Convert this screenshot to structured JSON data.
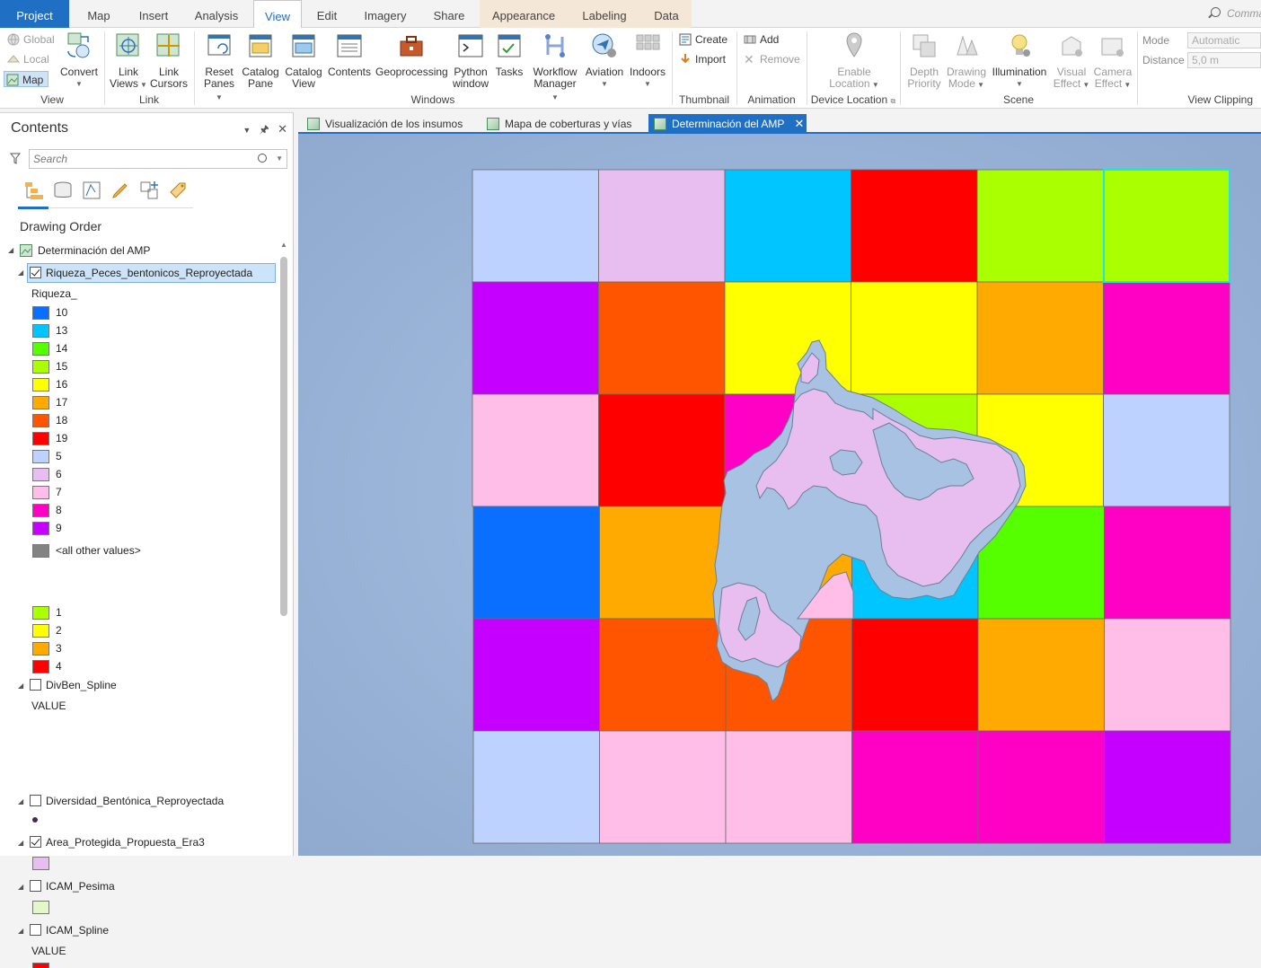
{
  "ribbon_tabs": {
    "project": "Project",
    "map": "Map",
    "insert": "Insert",
    "analysis": "Analysis",
    "view": "View",
    "edit": "Edit",
    "imagery": "Imagery",
    "share": "Share",
    "appearance": "Appearance",
    "labeling": "Labeling",
    "data": "Data"
  },
  "command_search": {
    "placeholder": "Comma"
  },
  "ribbon": {
    "view_group": {
      "global": "Global",
      "local": "Local",
      "map": "Map",
      "convert": "Convert",
      "label": "View"
    },
    "link_group": {
      "link_views_1": "Link",
      "link_views_2": "Views",
      "link_cursors_1": "Link",
      "link_cursors_2": "Cursors",
      "label": "Link"
    },
    "windows_group": {
      "reset_panes_1": "Reset",
      "reset_panes_2": "Panes",
      "catalog_pane_1": "Catalog",
      "catalog_pane_2": "Pane",
      "catalog_view_1": "Catalog",
      "catalog_view_2": "View",
      "contents": "Contents",
      "geoprocessing": "Geoprocessing",
      "python_1": "Python",
      "python_2": "window",
      "tasks": "Tasks",
      "workflow_1": "Workflow",
      "workflow_2": "Manager",
      "aviation": "Aviation",
      "indoors": "Indoors",
      "label": "Windows"
    },
    "thumbnail_group": {
      "create": "Create",
      "import": "Import",
      "label": "Thumbnail"
    },
    "animation_group": {
      "add": "Add",
      "remove": "Remove",
      "label": "Animation"
    },
    "device_group": {
      "enable_1": "Enable",
      "enable_2": "Location",
      "label": "Device Location"
    },
    "scene_group": {
      "depth_1": "Depth",
      "depth_2": "Priority",
      "drawing_1": "Drawing",
      "drawing_2": "Mode",
      "illumination": "Illumination",
      "visual_1": "Visual",
      "visual_2": "Effect",
      "camera_1": "Camera",
      "camera_2": "Effect",
      "label": "Scene"
    },
    "clipping_group": {
      "mode_label": "Mode",
      "mode_value": "Automatic",
      "distance_label": "Distance",
      "distance_value": "5,0  m",
      "label": "View Clipping"
    }
  },
  "contents": {
    "title": "Contents",
    "search_placeholder": "Search",
    "drawing_order": "Drawing Order",
    "map_name": "Determinación del AMP",
    "layers": [
      {
        "name": "Riqueza_Peces_bentonicos_Reproyectada",
        "checked": true,
        "field": "Riqueza_",
        "classes": [
          {
            "label": "10",
            "color": "#0a6eff"
          },
          {
            "label": "13",
            "color": "#00c5ff"
          },
          {
            "label": "14",
            "color": "#55ff00"
          },
          {
            "label": "15",
            "color": "#aaff00"
          },
          {
            "label": "16",
            "color": "#ffff00"
          },
          {
            "label": "17",
            "color": "#ffaa00"
          },
          {
            "label": "18",
            "color": "#ff5500"
          },
          {
            "label": "19",
            "color": "#ff0000"
          },
          {
            "label": "5",
            "color": "#bed2ff"
          },
          {
            "label": "6",
            "color": "#e8bef0"
          },
          {
            "label": "7",
            "color": "#ffbee8"
          },
          {
            "label": "8",
            "color": "#ff00c5"
          },
          {
            "label": "9",
            "color": "#c500ff"
          },
          {
            "label": "<all other values>",
            "color": "#828282"
          }
        ]
      },
      {
        "name": "DivBen_Spline",
        "checked": false,
        "field": "VALUE",
        "classes": [
          {
            "label": "1",
            "color": "#aaff00"
          },
          {
            "label": "2",
            "color": "#ffff00"
          },
          {
            "label": "3",
            "color": "#ffaa00"
          },
          {
            "label": "4",
            "color": "#ff0000"
          }
        ]
      },
      {
        "name": "Diversidad_Bentónica_Reproyectada",
        "checked": false
      },
      {
        "name": "Area_Protegida_Propuesta_Era3",
        "checked": true
      },
      {
        "name": "ICAM_Pesima",
        "checked": false
      },
      {
        "name": "ICAM_Spline",
        "checked": false,
        "field": "VALUE"
      }
    ]
  },
  "map_tabs": [
    {
      "label": "Visualización de los insumos",
      "active": false
    },
    {
      "label": "Mapa de coberturas y vías",
      "active": false
    },
    {
      "label": "Determinación del AMP",
      "active": true
    }
  ],
  "map_grid": {
    "rows": [
      [
        "#bed2ff",
        "#e8bef0",
        "#00c5ff",
        "#ff0000",
        "#aaff00",
        "#aaff00"
      ],
      [
        "#c500ff",
        "#ff5500",
        "#ffff00",
        "#ffff00",
        "#ffaa00",
        "#ff00c5"
      ],
      [
        "#ffbee8",
        "#ff0000",
        "#ff00c5",
        "#aaff00",
        "#ffff00",
        "#bed2ff"
      ],
      [
        "#0a6eff",
        "#ffaa00",
        "#ffaa00",
        "#00c5ff",
        "#55ff00",
        "#ff00c5"
      ],
      [
        "#c500ff",
        "#ff5500",
        "#ff5500",
        "#ff0000",
        "#ffaa00",
        "#ffbee8"
      ],
      [
        "#bed2ff",
        "#ffbee8",
        "#ffbee8",
        "#ff00c5",
        "#ff00c5",
        "#c500ff"
      ]
    ],
    "selected_cell": "row 1, column 6",
    "island_fill": "#e8bef0",
    "island_water": "#a7c2e3"
  }
}
